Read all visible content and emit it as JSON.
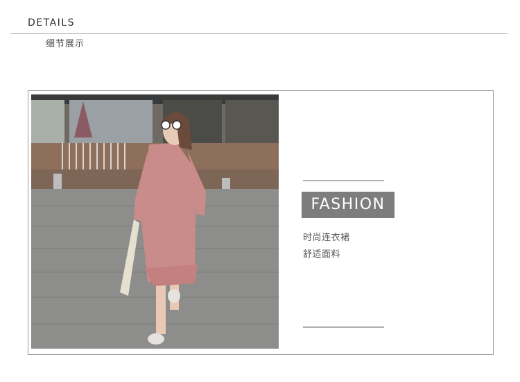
{
  "header": {
    "title": "DETAILS",
    "subtitle": "细节展示"
  },
  "card": {
    "badge": "FASHION",
    "lines": [
      "时尚连衣裙",
      "舒适面料"
    ]
  },
  "photo": {
    "description_icon": "product-photo"
  },
  "colors": {
    "badge_bg": "#7d7d7d",
    "rule": "#b0b0b0",
    "border": "#9a9a9a",
    "dress": "#c98c8a"
  }
}
